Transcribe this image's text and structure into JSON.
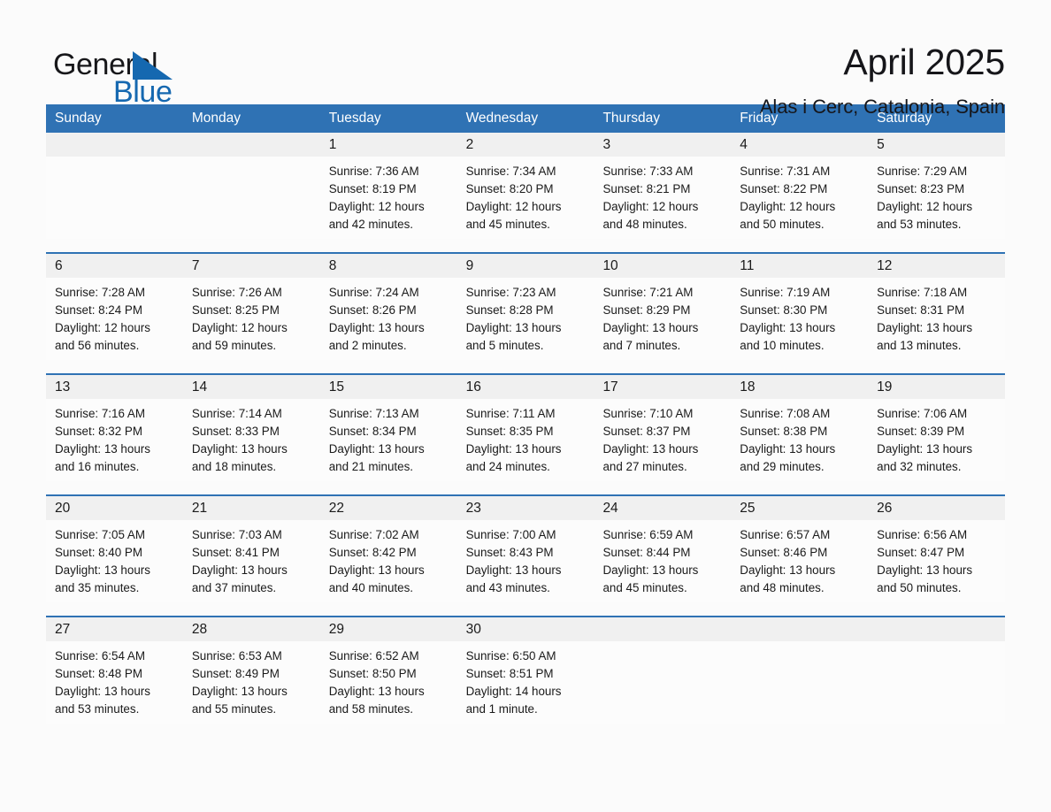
{
  "brand": {
    "name_part1": "General",
    "name_part2": "Blue",
    "accent_color": "#1568b0",
    "triangle_icon": "triangle-icon"
  },
  "header": {
    "month_title": "April 2025",
    "location": "Alas i Cerc, Catalonia, Spain"
  },
  "calendar": {
    "header_bg": "#2f72b4",
    "daynum_bg": "#f0f0f0",
    "weekdays": [
      "Sunday",
      "Monday",
      "Tuesday",
      "Wednesday",
      "Thursday",
      "Friday",
      "Saturday"
    ],
    "weeks": [
      [
        {
          "day": "",
          "lines": []
        },
        {
          "day": "",
          "lines": []
        },
        {
          "day": "1",
          "lines": [
            "Sunrise: 7:36 AM",
            "Sunset: 8:19 PM",
            "Daylight: 12 hours",
            "and 42 minutes."
          ]
        },
        {
          "day": "2",
          "lines": [
            "Sunrise: 7:34 AM",
            "Sunset: 8:20 PM",
            "Daylight: 12 hours",
            "and 45 minutes."
          ]
        },
        {
          "day": "3",
          "lines": [
            "Sunrise: 7:33 AM",
            "Sunset: 8:21 PM",
            "Daylight: 12 hours",
            "and 48 minutes."
          ]
        },
        {
          "day": "4",
          "lines": [
            "Sunrise: 7:31 AM",
            "Sunset: 8:22 PM",
            "Daylight: 12 hours",
            "and 50 minutes."
          ]
        },
        {
          "day": "5",
          "lines": [
            "Sunrise: 7:29 AM",
            "Sunset: 8:23 PM",
            "Daylight: 12 hours",
            "and 53 minutes."
          ]
        }
      ],
      [
        {
          "day": "6",
          "lines": [
            "Sunrise: 7:28 AM",
            "Sunset: 8:24 PM",
            "Daylight: 12 hours",
            "and 56 minutes."
          ]
        },
        {
          "day": "7",
          "lines": [
            "Sunrise: 7:26 AM",
            "Sunset: 8:25 PM",
            "Daylight: 12 hours",
            "and 59 minutes."
          ]
        },
        {
          "day": "8",
          "lines": [
            "Sunrise: 7:24 AM",
            "Sunset: 8:26 PM",
            "Daylight: 13 hours",
            "and 2 minutes."
          ]
        },
        {
          "day": "9",
          "lines": [
            "Sunrise: 7:23 AM",
            "Sunset: 8:28 PM",
            "Daylight: 13 hours",
            "and 5 minutes."
          ]
        },
        {
          "day": "10",
          "lines": [
            "Sunrise: 7:21 AM",
            "Sunset: 8:29 PM",
            "Daylight: 13 hours",
            "and 7 minutes."
          ]
        },
        {
          "day": "11",
          "lines": [
            "Sunrise: 7:19 AM",
            "Sunset: 8:30 PM",
            "Daylight: 13 hours",
            "and 10 minutes."
          ]
        },
        {
          "day": "12",
          "lines": [
            "Sunrise: 7:18 AM",
            "Sunset: 8:31 PM",
            "Daylight: 13 hours",
            "and 13 minutes."
          ]
        }
      ],
      [
        {
          "day": "13",
          "lines": [
            "Sunrise: 7:16 AM",
            "Sunset: 8:32 PM",
            "Daylight: 13 hours",
            "and 16 minutes."
          ]
        },
        {
          "day": "14",
          "lines": [
            "Sunrise: 7:14 AM",
            "Sunset: 8:33 PM",
            "Daylight: 13 hours",
            "and 18 minutes."
          ]
        },
        {
          "day": "15",
          "lines": [
            "Sunrise: 7:13 AM",
            "Sunset: 8:34 PM",
            "Daylight: 13 hours",
            "and 21 minutes."
          ]
        },
        {
          "day": "16",
          "lines": [
            "Sunrise: 7:11 AM",
            "Sunset: 8:35 PM",
            "Daylight: 13 hours",
            "and 24 minutes."
          ]
        },
        {
          "day": "17",
          "lines": [
            "Sunrise: 7:10 AM",
            "Sunset: 8:37 PM",
            "Daylight: 13 hours",
            "and 27 minutes."
          ]
        },
        {
          "day": "18",
          "lines": [
            "Sunrise: 7:08 AM",
            "Sunset: 8:38 PM",
            "Daylight: 13 hours",
            "and 29 minutes."
          ]
        },
        {
          "day": "19",
          "lines": [
            "Sunrise: 7:06 AM",
            "Sunset: 8:39 PM",
            "Daylight: 13 hours",
            "and 32 minutes."
          ]
        }
      ],
      [
        {
          "day": "20",
          "lines": [
            "Sunrise: 7:05 AM",
            "Sunset: 8:40 PM",
            "Daylight: 13 hours",
            "and 35 minutes."
          ]
        },
        {
          "day": "21",
          "lines": [
            "Sunrise: 7:03 AM",
            "Sunset: 8:41 PM",
            "Daylight: 13 hours",
            "and 37 minutes."
          ]
        },
        {
          "day": "22",
          "lines": [
            "Sunrise: 7:02 AM",
            "Sunset: 8:42 PM",
            "Daylight: 13 hours",
            "and 40 minutes."
          ]
        },
        {
          "day": "23",
          "lines": [
            "Sunrise: 7:00 AM",
            "Sunset: 8:43 PM",
            "Daylight: 13 hours",
            "and 43 minutes."
          ]
        },
        {
          "day": "24",
          "lines": [
            "Sunrise: 6:59 AM",
            "Sunset: 8:44 PM",
            "Daylight: 13 hours",
            "and 45 minutes."
          ]
        },
        {
          "day": "25",
          "lines": [
            "Sunrise: 6:57 AM",
            "Sunset: 8:46 PM",
            "Daylight: 13 hours",
            "and 48 minutes."
          ]
        },
        {
          "day": "26",
          "lines": [
            "Sunrise: 6:56 AM",
            "Sunset: 8:47 PM",
            "Daylight: 13 hours",
            "and 50 minutes."
          ]
        }
      ],
      [
        {
          "day": "27",
          "lines": [
            "Sunrise: 6:54 AM",
            "Sunset: 8:48 PM",
            "Daylight: 13 hours",
            "and 53 minutes."
          ]
        },
        {
          "day": "28",
          "lines": [
            "Sunrise: 6:53 AM",
            "Sunset: 8:49 PM",
            "Daylight: 13 hours",
            "and 55 minutes."
          ]
        },
        {
          "day": "29",
          "lines": [
            "Sunrise: 6:52 AM",
            "Sunset: 8:50 PM",
            "Daylight: 13 hours",
            "and 58 minutes."
          ]
        },
        {
          "day": "30",
          "lines": [
            "Sunrise: 6:50 AM",
            "Sunset: 8:51 PM",
            "Daylight: 14 hours",
            "and 1 minute."
          ]
        },
        {
          "day": "",
          "lines": []
        },
        {
          "day": "",
          "lines": []
        },
        {
          "day": "",
          "lines": []
        }
      ]
    ]
  }
}
